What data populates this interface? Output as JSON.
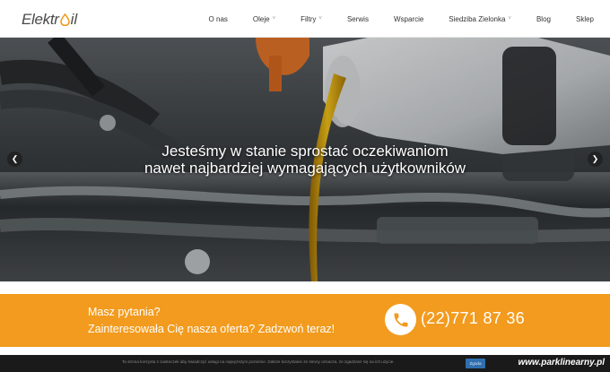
{
  "header": {
    "logo_part1": "Elektr",
    "logo_part2": "il",
    "nav": [
      {
        "label": "O nas",
        "dropdown": false
      },
      {
        "label": "Oleje",
        "dropdown": true
      },
      {
        "label": "Filtry",
        "dropdown": true
      },
      {
        "label": "Serwis",
        "dropdown": false
      },
      {
        "label": "Wsparcie",
        "dropdown": false
      },
      {
        "label": "Siedziba Zielonka",
        "dropdown": true
      },
      {
        "label": "Blog",
        "dropdown": false
      },
      {
        "label": "Sklep",
        "dropdown": false
      }
    ]
  },
  "hero": {
    "line1": "Jesteśmy w stanie sprostać oczekiwaniom",
    "line2": "nawet najbardziej wymagających użytkowników",
    "prev_icon": "chevron-left-icon",
    "next_icon": "chevron-right-icon"
  },
  "contact": {
    "question": "Masz pytania?",
    "cta": "Zainteresowała Cię nasza oferta? Zadzwoń teraz!",
    "phone": "(22)771 87 36",
    "icon": "phone-icon",
    "color": "#f29b1e"
  },
  "cookie": {
    "text": "Ta strona korzysta z ciasteczek aby świadczyć usługi na najwyższym poziomie. Dalsze korzystanie ze strony oznacza, że zgadzasz się na ich użycie.",
    "button": "Zgoda"
  },
  "watermark": "www.parklinearny.pl",
  "colors": {
    "accent": "#f29b1e",
    "brand_text": "#4a4a4a"
  }
}
